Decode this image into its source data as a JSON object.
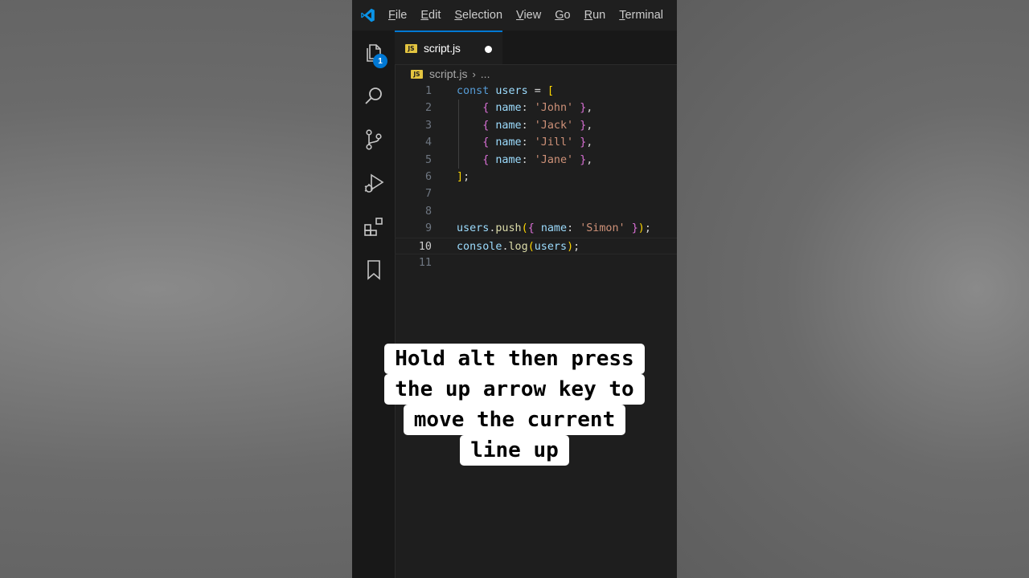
{
  "menu": [
    "File",
    "Edit",
    "Selection",
    "View",
    "Go",
    "Run",
    "Terminal"
  ],
  "activity": {
    "explorer_badge": "1",
    "icons": [
      "files-icon",
      "search-icon",
      "source-control-icon",
      "run-debug-icon",
      "extensions-icon",
      "bookmark-icon"
    ]
  },
  "tab": {
    "label": "script.js",
    "icon": "JS",
    "modified": true
  },
  "breadcrumb": {
    "file": "script.js",
    "separator": "›",
    "rest": "..."
  },
  "editor": {
    "current_line": 10,
    "lines": [
      {
        "n": "1",
        "tokens": [
          [
            "kw",
            "const "
          ],
          [
            "var",
            "users"
          ],
          [
            "plain",
            " = "
          ],
          [
            "br1",
            "["
          ]
        ]
      },
      {
        "n": "2",
        "tokens": [
          [
            "plain",
            "    "
          ],
          [
            "br2",
            "{"
          ],
          [
            "plain",
            " "
          ],
          [
            "prop",
            "name"
          ],
          [
            "plain",
            ": "
          ],
          [
            "str",
            "'John'"
          ],
          [
            "plain",
            " "
          ],
          [
            "br2",
            "}"
          ],
          [
            "plain",
            ","
          ]
        ]
      },
      {
        "n": "3",
        "tokens": [
          [
            "plain",
            "    "
          ],
          [
            "br2",
            "{"
          ],
          [
            "plain",
            " "
          ],
          [
            "prop",
            "name"
          ],
          [
            "plain",
            ": "
          ],
          [
            "str",
            "'Jack'"
          ],
          [
            "plain",
            " "
          ],
          [
            "br2",
            "}"
          ],
          [
            "plain",
            ","
          ]
        ]
      },
      {
        "n": "4",
        "tokens": [
          [
            "plain",
            "    "
          ],
          [
            "br2",
            "{"
          ],
          [
            "plain",
            " "
          ],
          [
            "prop",
            "name"
          ],
          [
            "plain",
            ": "
          ],
          [
            "str",
            "'Jill'"
          ],
          [
            "plain",
            " "
          ],
          [
            "br2",
            "}"
          ],
          [
            "plain",
            ","
          ]
        ]
      },
      {
        "n": "5",
        "tokens": [
          [
            "plain",
            "    "
          ],
          [
            "br2",
            "{"
          ],
          [
            "plain",
            " "
          ],
          [
            "prop",
            "name"
          ],
          [
            "plain",
            ": "
          ],
          [
            "str",
            "'Jane'"
          ],
          [
            "plain",
            " "
          ],
          [
            "br2",
            "}"
          ],
          [
            "plain",
            ","
          ]
        ]
      },
      {
        "n": "6",
        "tokens": [
          [
            "br1",
            "]"
          ],
          [
            "plain",
            ";"
          ]
        ]
      },
      {
        "n": "7",
        "tokens": []
      },
      {
        "n": "8",
        "tokens": []
      },
      {
        "n": "9",
        "tokens": [
          [
            "var",
            "users"
          ],
          [
            "plain",
            "."
          ],
          [
            "fn",
            "push"
          ],
          [
            "br1",
            "("
          ],
          [
            "br2",
            "{"
          ],
          [
            "plain",
            " "
          ],
          [
            "prop",
            "name"
          ],
          [
            "plain",
            ": "
          ],
          [
            "str",
            "'Simon'"
          ],
          [
            "plain",
            " "
          ],
          [
            "br2",
            "}"
          ],
          [
            "br1",
            ")"
          ],
          [
            "plain",
            ";"
          ]
        ]
      },
      {
        "n": "10",
        "tokens": [
          [
            "var",
            "console"
          ],
          [
            "plain",
            "."
          ],
          [
            "fn",
            "log"
          ],
          [
            "br1",
            "("
          ],
          [
            "var",
            "users"
          ],
          [
            "br1",
            ")"
          ],
          [
            "plain",
            ";"
          ]
        ]
      },
      {
        "n": "11",
        "tokens": []
      }
    ]
  },
  "caption": {
    "lines": [
      "Hold alt then press",
      "the up arrow key to",
      "move the current",
      "line up"
    ]
  },
  "colors": {
    "accent": "#0078d4",
    "editor_bg": "#1e1e1e",
    "js_icon": "#e3c440"
  }
}
